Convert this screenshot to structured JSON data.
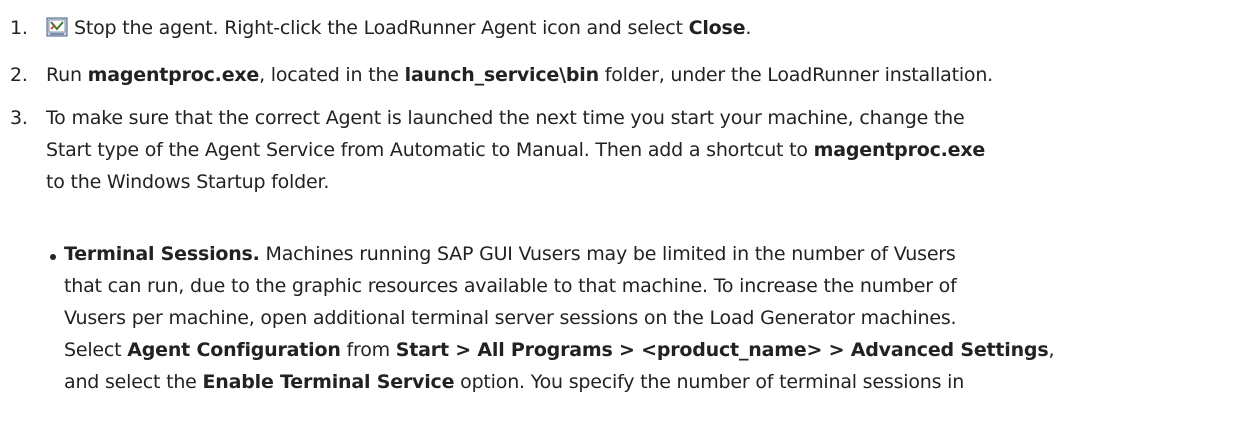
{
  "steps": [
    {
      "number": "1.",
      "icon": "loadrunner-agent-icon",
      "text_a": "Stop the agent. Right-click the LoadRunner Agent icon and select ",
      "bold_a": "Close",
      "text_b": "."
    },
    {
      "number": "2.",
      "text_a": "Run ",
      "bold_a": "magentproc.exe",
      "text_b": ", located in the ",
      "bold_b": "launch_service\\bin",
      "text_c": " folder, under the LoadRunner installation."
    },
    {
      "number": "3.",
      "line1": "To make sure that the correct Agent is launched the next time you start your machine, change the",
      "line2_a": "Start type of the Agent Service from Automatic to Manual. Then add a shortcut to ",
      "line2_bold": "magentproc.exe",
      "line3": "to the Windows Startup folder."
    }
  ],
  "bullet": {
    "title": "Terminal Sessions.",
    "line1_rest": " Machines running SAP GUI Vusers may be limited in the number of Vusers",
    "line2": "that can run, due to the graphic resources available to that machine. To increase the number of",
    "line3": "Vusers per machine, open additional terminal server sessions on the Load Generator machines.",
    "line4_a": "Select ",
    "line4_bold_a": "Agent Configuration",
    "line4_b": " from ",
    "line4_bold_b": "Start > All Programs > <product_name> > Advanced Settings",
    "line4_c": ",",
    "line5_a": "and select the ",
    "line5_bold": "Enable Terminal Service",
    "line5_b": " option. You specify the number of terminal sessions in"
  }
}
